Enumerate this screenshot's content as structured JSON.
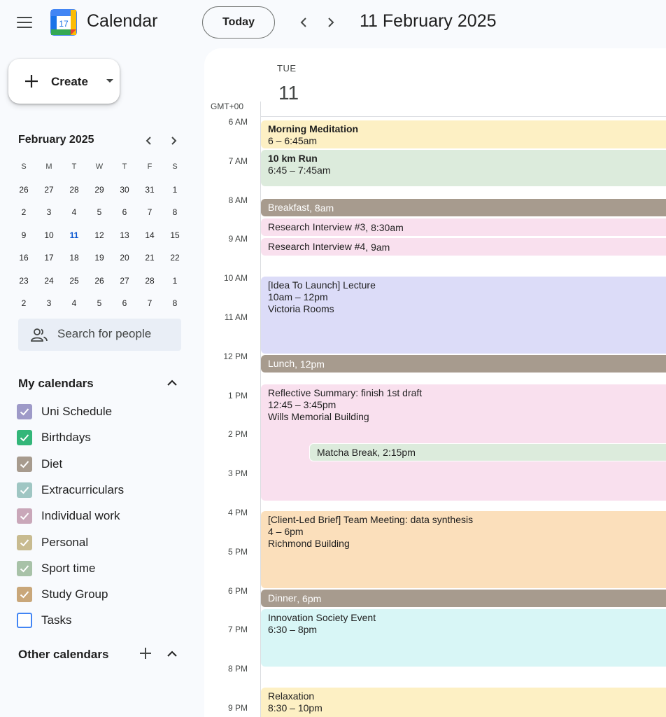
{
  "header": {
    "app_title": "Calendar",
    "logo_number": "17",
    "today_label": "Today",
    "date_title": "11 February 2025"
  },
  "create": {
    "label": "Create"
  },
  "mini_calendar": {
    "title": "February 2025",
    "weekdays": [
      "S",
      "M",
      "T",
      "W",
      "T",
      "F",
      "S"
    ],
    "weeks": [
      [
        "26",
        "27",
        "28",
        "29",
        "30",
        "31",
        "1"
      ],
      [
        "2",
        "3",
        "4",
        "5",
        "6",
        "7",
        "8"
      ],
      [
        "9",
        "10",
        "11",
        "12",
        "13",
        "14",
        "15"
      ],
      [
        "16",
        "17",
        "18",
        "19",
        "20",
        "21",
        "22"
      ],
      [
        "23",
        "24",
        "25",
        "26",
        "27",
        "28",
        "1"
      ],
      [
        "2",
        "3",
        "4",
        "5",
        "6",
        "7",
        "8"
      ]
    ],
    "selected": "11"
  },
  "search": {
    "placeholder": "Search for people"
  },
  "my_calendars": {
    "title": "My calendars",
    "items": [
      {
        "label": "Uni Schedule",
        "color": "#9e9ac8",
        "checked": true
      },
      {
        "label": "Birthdays",
        "color": "#33b679",
        "checked": true
      },
      {
        "label": "Diet",
        "color": "#a79b8e",
        "checked": true
      },
      {
        "label": "Extracurriculars",
        "color": "#9fc6c3",
        "checked": true
      },
      {
        "label": "Individual work",
        "color": "#c9a7b9",
        "checked": true
      },
      {
        "label": "Personal",
        "color": "#c8bb90",
        "checked": true
      },
      {
        "label": "Sport time",
        "color": "#a8c2a8",
        "checked": true
      },
      {
        "label": "Study Group",
        "color": "#c9a77a",
        "checked": true
      },
      {
        "label": "Tasks",
        "color": "#4285f4",
        "checked": false
      }
    ]
  },
  "other_calendars": {
    "title": "Other calendars"
  },
  "day_view": {
    "day_name": "TUE",
    "day_number": "11",
    "timezone": "GMT+00",
    "hours": [
      "6 AM",
      "7 AM",
      "8 AM",
      "9 AM",
      "10 AM",
      "11 AM",
      "12 PM",
      "1 PM",
      "2 PM",
      "3 PM",
      "4 PM",
      "5 PM",
      "6 PM",
      "7 PM",
      "8 PM",
      "9 PM"
    ]
  },
  "events": {
    "meditation": {
      "title": "Morning Meditation",
      "time": "6 – 6:45am",
      "color": "#fdf0c4"
    },
    "run": {
      "title": "10 km Run",
      "time": "6:45 – 7:45am",
      "color": "#dcebdc"
    },
    "breakfast": {
      "title": "Breakfast",
      "time": ", 8am",
      "color": "#a79b8e"
    },
    "interview3": {
      "title": "Research Interview #3",
      "time": ", 8:30am",
      "color": "#f9e0ee"
    },
    "interview4": {
      "title": "Research Interview #4",
      "time": ", 9am",
      "color": "#f9e0ee"
    },
    "lecture": {
      "title": "[Idea To Launch] Lecture",
      "time": "10am – 12pm",
      "location": "Victoria Rooms",
      "color": "#dcdcf8"
    },
    "lunch": {
      "title": "Lunch",
      "time": ", 12pm",
      "color": "#a79b8e"
    },
    "reflective": {
      "title": "Reflective Summary: finish 1st draft",
      "time": "12:45 – 3:45pm",
      "location": "Wills Memorial Building",
      "color": "#f9e0ee"
    },
    "matcha": {
      "title": "Matcha Break",
      "time": ", 2:15pm",
      "color": "#dcebdc"
    },
    "meeting": {
      "title": "[Client-Led Brief] Team Meeting: data synthesis",
      "time": "4 – 6pm",
      "location": "Richmond Building",
      "color": "#fbdfbb"
    },
    "dinner": {
      "title": "Dinner",
      "time": ", 6pm",
      "color": "#a79b8e"
    },
    "innovation": {
      "title": "Innovation Society Event",
      "time": "6:30 – 8pm",
      "color": "#d8f6f6"
    },
    "relaxation": {
      "title": "Relaxation",
      "time": "8:30 – 10pm",
      "color": "#fdf0c4"
    }
  }
}
